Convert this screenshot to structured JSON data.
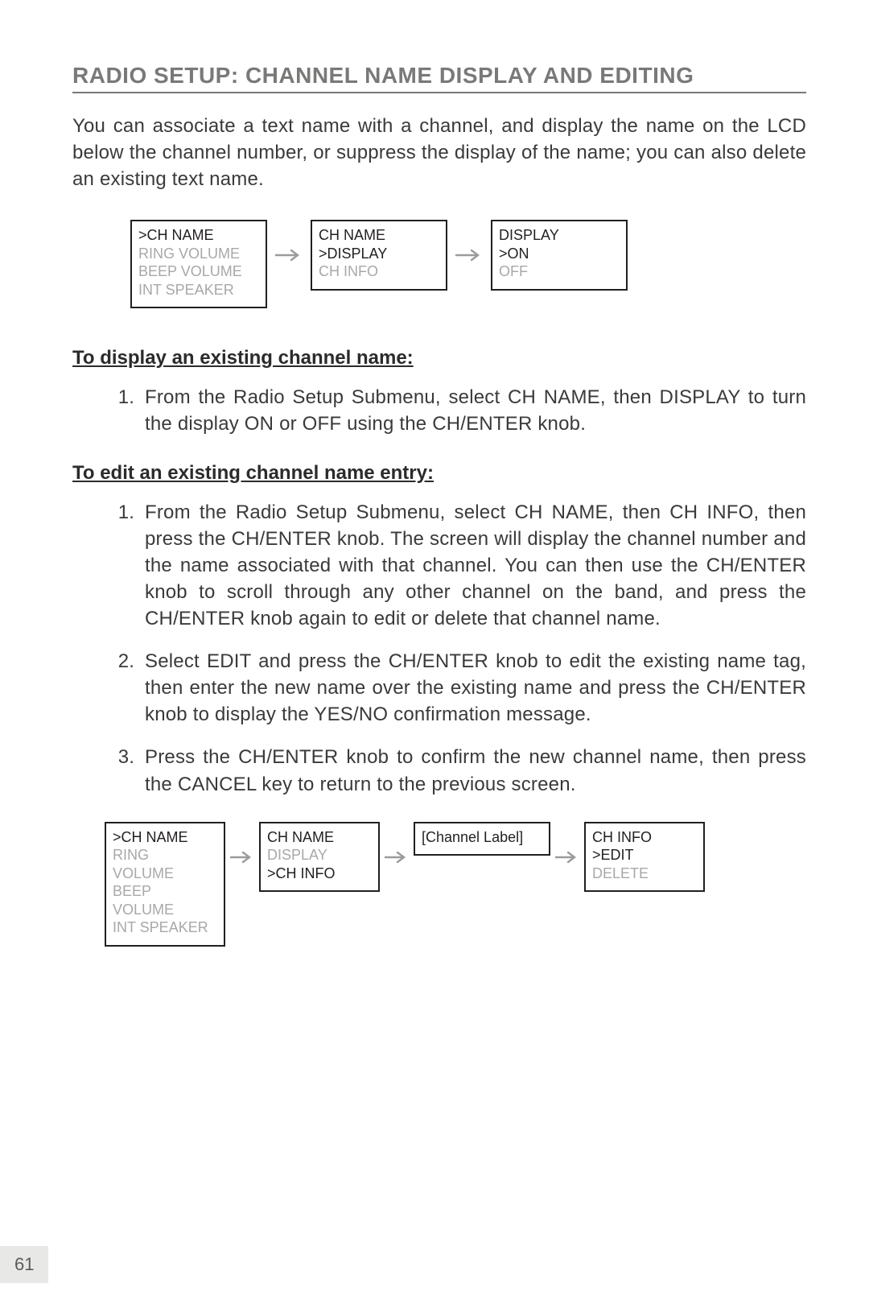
{
  "title": "RADIO SETUP: CHANNEL NAME DISPLAY AND EDITING",
  "intro": "You can associate a text name with a channel, and display the name on the LCD below the channel number, or suppress the display of the name; you can also delete an existing text name.",
  "flow1": {
    "box1": {
      "l1": ">CH NAME",
      "l2": "RING VOLUME",
      "l3": "BEEP VOLUME",
      "l4": "INT SPEAKER"
    },
    "box2": {
      "l1": "CH NAME",
      "l2": ">DISPLAY",
      "l3": "CH INFO"
    },
    "box3": {
      "l1": "DISPLAY",
      "l2": ">ON",
      "l3": "OFF"
    }
  },
  "section1": {
    "head": "To display an existing channel name:",
    "step1": "From the Radio Setup Submenu, select CH NAME, then DISPLAY to turn the display ON or OFF using the CH/ENTER knob."
  },
  "section2": {
    "head": "To edit an existing channel name entry:",
    "step1": "From the Radio Setup Submenu, select CH NAME, then CH INFO, then press the CH/ENTER knob. The screen will display the channel number and the name associated with that channel. You can then use the CH/ENTER knob to scroll through any other channel on the band, and press the CH/ENTER knob again to edit or delete that channel name.",
    "step2": "Select EDIT and press the CH/ENTER knob to edit the existing name tag, then enter the new name over the existing name and press the CH/ENTER knob to display the YES/NO confirmation message.",
    "step3": "Press the CH/ENTER knob to confirm the new channel name, then press the CANCEL key to return to the previous screen."
  },
  "flow2": {
    "box1": {
      "l1": ">CH NAME",
      "l2": "RING",
      "l3": "VOLUME",
      "l4": "BEEP",
      "l5": "VOLUME",
      "l6": "INT SPEAKER"
    },
    "box2": {
      "l1": "CH NAME",
      "l2": "DISPLAY",
      "l3": ">CH INFO"
    },
    "box3": {
      "l1": "[Channel Label]"
    },
    "box4": {
      "l1": "CH INFO",
      "l2": ">EDIT",
      "l3": "DELETE"
    }
  },
  "pagenum": "61"
}
